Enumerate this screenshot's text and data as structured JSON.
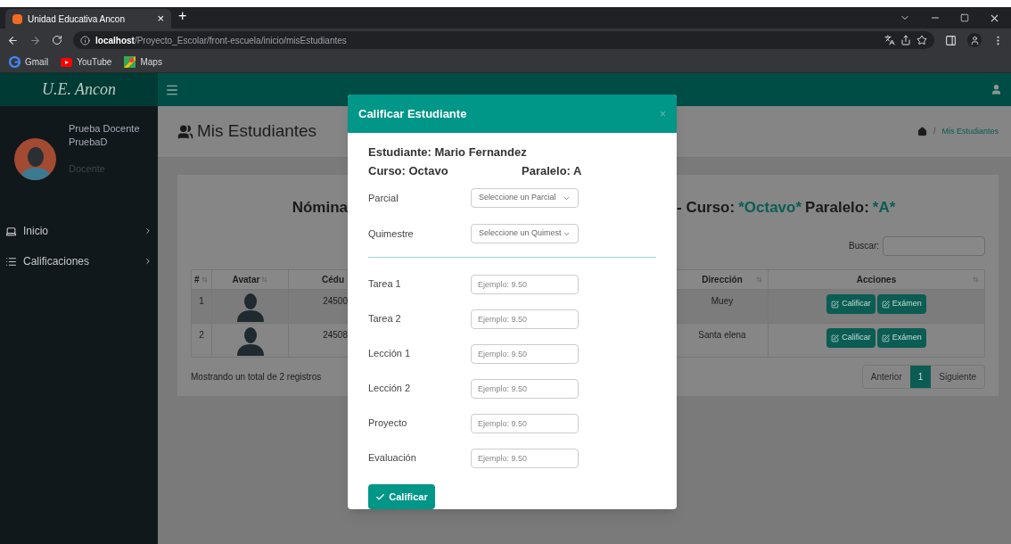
{
  "browser": {
    "tab": {
      "title": "Unidad Educativa Ancon",
      "close": "×"
    },
    "new_tab": "+",
    "url": "**localhost**/Proyecto_Escolar/front-escuela/inicio/misEstudiantes",
    "bookmarks": [
      {
        "label": "Gmail",
        "kind": "google"
      },
      {
        "label": "YouTube",
        "kind": "youtube"
      },
      {
        "label": "Maps",
        "kind": "maps"
      }
    ]
  },
  "app": {
    "logo": "U.E. Ancon",
    "user": {
      "name": "Prueba Docente PruebaD",
      "role": "Docente"
    },
    "sidebar": {
      "items": [
        {
          "label": "Inicio",
          "kind": "laptop"
        },
        {
          "label": "Calificaciones",
          "kind": "list"
        }
      ]
    },
    "page_title": "Mis Estudiantes",
    "breadcrumb": {
      "separator": "/",
      "current": "Mis Estudiantes"
    },
    "card": {
      "heading_left": "Nómina",
      "heading_right": [
        {
          "text": "- Curso:",
          "accent": false
        },
        {
          "text": "*Octavo*",
          "accent": true
        },
        {
          "text": "Paralelo:",
          "accent": false
        },
        {
          "text": "*A*",
          "accent": true
        }
      ],
      "search_label": "Buscar:",
      "columns_left": [
        "#",
        "Avatar",
        "Cédu"
      ],
      "columns_right": [
        "Dirección",
        "Acciones"
      ],
      "rows": [
        {
          "number": "1",
          "cedula": "24500",
          "direccion": "Muey",
          "actions": [
            "Calificar",
            "Exámen"
          ]
        },
        {
          "number": "2",
          "cedula": "24508",
          "direccion": "Santa elena",
          "actions": [
            "Calificar",
            "Exámen"
          ]
        }
      ],
      "footer": "Mostrando un total de 2 registros",
      "pagination": [
        {
          "label": "Anterior",
          "selected": false
        },
        {
          "label": "1",
          "selected": true
        },
        {
          "label": "Siguiente",
          "selected": false
        }
      ]
    }
  },
  "modal": {
    "title": "Calificar Estudiante",
    "close": "×",
    "student": "Estudiante: Mario Fernandez",
    "course": "Curso: Octavo",
    "paralelo": "Paralelo: A",
    "selects": [
      {
        "label": "Parcial",
        "placeholder": "Seleccione un Parcial"
      },
      {
        "label": "Quimestre",
        "placeholder": "Seleccione un Quimest"
      }
    ],
    "inputs": [
      {
        "label": "Tarea 1",
        "placeholder": "Ejemplo: 9.50"
      },
      {
        "label": "Tarea 2",
        "placeholder": "Ejemplo: 9.50"
      },
      {
        "label": "Lección 1",
        "placeholder": "Ejemplo: 9.50"
      },
      {
        "label": "Lección 2",
        "placeholder": "Ejemplo: 9.50"
      },
      {
        "label": "Proyecto",
        "placeholder": "Ejemplo: 9.50"
      },
      {
        "label": "Evaluación",
        "placeholder": "Ejemplo: 9.50"
      }
    ],
    "submit": "Calificar"
  }
}
